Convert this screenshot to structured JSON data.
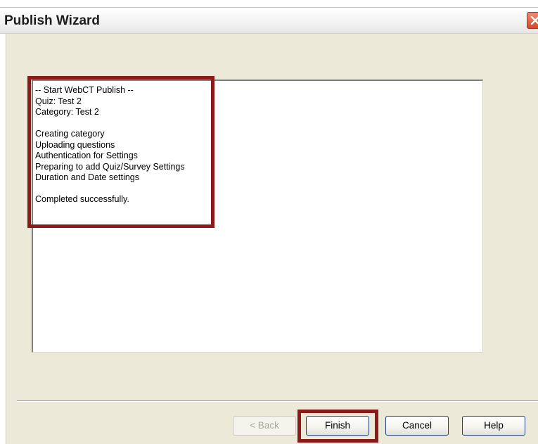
{
  "window": {
    "title": "Publish Wizard"
  },
  "log": {
    "lines": [
      "-- Start WebCT Publish --",
      "Quiz: Test 2",
      "Category: Test 2",
      "",
      "Creating category",
      "Uploading questions",
      "Authentication for Settings",
      "Preparing to add Quiz/Survey Settings",
      "Duration and Date settings",
      "",
      "Completed successfully."
    ]
  },
  "buttons": {
    "back": "< Back",
    "finish": "Finish",
    "cancel": "Cancel",
    "help": "Help"
  },
  "icons": {
    "close": "close-icon"
  },
  "colors": {
    "highlight": "#8b1a1a",
    "dialog_background": "#ece9d8",
    "close_button": "#d44a2a"
  }
}
